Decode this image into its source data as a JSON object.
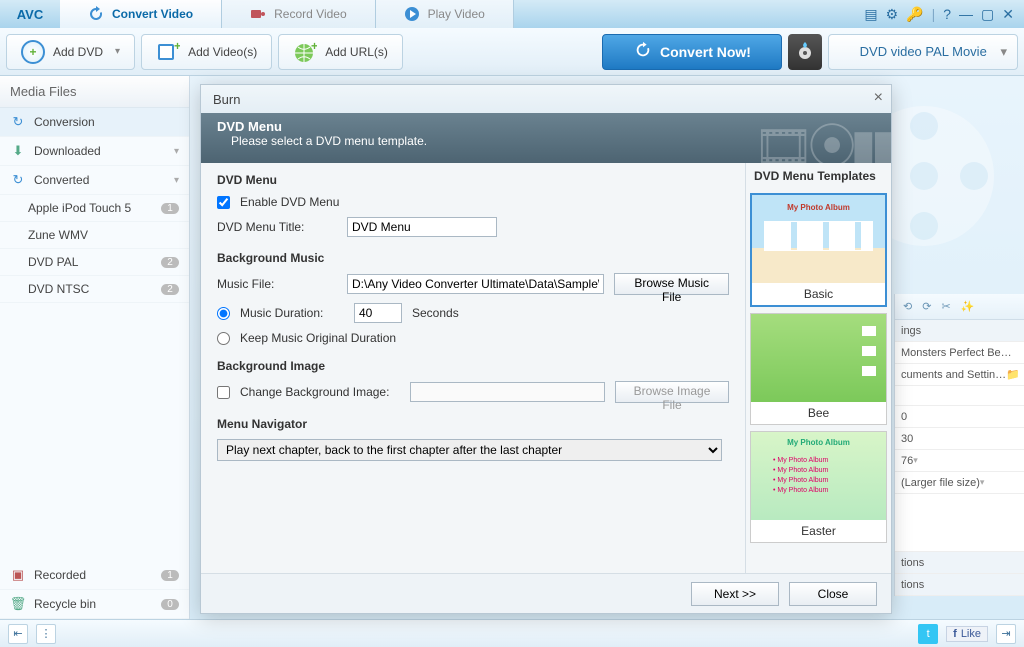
{
  "app": {
    "logo": "AVC"
  },
  "tabs": [
    {
      "label": "Convert Video",
      "active": true
    },
    {
      "label": "Record Video",
      "active": false
    },
    {
      "label": "Play Video",
      "active": false
    }
  ],
  "toolbar": {
    "add_dvd": "Add DVD",
    "add_videos": "Add Video(s)",
    "add_urls": "Add URL(s)",
    "convert_now": "Convert Now!",
    "profile": "DVD video PAL Movie"
  },
  "sidebar": {
    "title": "Media Files",
    "items": [
      {
        "label": "Conversion",
        "icon": "↻",
        "active": true
      },
      {
        "label": "Downloaded",
        "icon": "⬇",
        "expand": true
      },
      {
        "label": "Converted",
        "icon": "↻",
        "expand": true
      }
    ],
    "subs": [
      {
        "label": "Apple iPod Touch 5",
        "badge": "1"
      },
      {
        "label": "Zune WMV",
        "badge": ""
      },
      {
        "label": "DVD PAL",
        "badge": "2"
      },
      {
        "label": "DVD NTSC",
        "badge": "2"
      }
    ],
    "bottom": [
      {
        "label": "Recorded",
        "icon": "▤",
        "badge": "1"
      },
      {
        "label": "Recycle bin",
        "icon": "🗑",
        "badge": "0"
      }
    ]
  },
  "dialog": {
    "title": "Burn",
    "banner_title": "DVD Menu",
    "banner_sub": "Please select a DVD menu template.",
    "sec_dvd": "DVD Menu",
    "enable_label": "Enable DVD Menu",
    "title_label": "DVD Menu Title:",
    "title_value": "DVD Menu",
    "sec_bgm": "Background Music",
    "music_file_label": "Music File:",
    "music_file_value": "D:\\Any Video Converter Ultimate\\Data\\Sample\\d",
    "browse_music": "Browse Music File",
    "music_duration_label": "Music Duration:",
    "music_duration_value": "40",
    "seconds": "Seconds",
    "keep_orig": "Keep Music Original Duration",
    "sec_bgi": "Background Image",
    "change_bg": "Change Background Image:",
    "browse_image": "Browse Image File",
    "sec_nav": "Menu Navigator",
    "nav_value": "Play next chapter, back to the first chapter after the last chapter",
    "templates_title": "DVD Menu Templates",
    "templates": [
      {
        "name": "Basic",
        "sel": true,
        "cls": "thumb-basic"
      },
      {
        "name": "Bee",
        "sel": false,
        "cls": "thumb-bee"
      },
      {
        "name": "Easter",
        "sel": false,
        "cls": "thumb-easter"
      }
    ],
    "next": "Next >>",
    "close": "Close"
  },
  "rightpanel": {
    "header": "ings",
    "rows": [
      "Monsters Perfect Be…",
      "cuments and Settin…",
      "0",
      "30",
      "76",
      "(Larger file size)",
      "tions",
      "tions"
    ]
  },
  "statusbar": {
    "like": "Like"
  }
}
